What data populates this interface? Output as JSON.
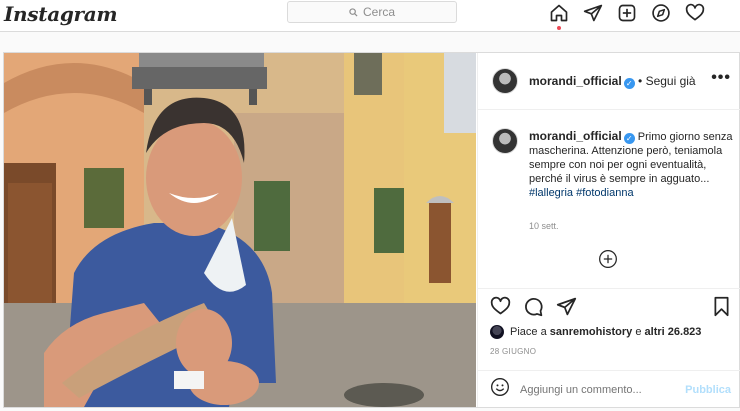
{
  "nav": {
    "logo": "Instagram",
    "search_placeholder": "Cerca",
    "icons": [
      "home-icon",
      "direct-icon",
      "new-post-icon",
      "explore-icon",
      "activity-heart-icon"
    ]
  },
  "post": {
    "author": "morandi_official",
    "follow_text": "• Segui già",
    "more": "•••",
    "caption": {
      "username": "morandi_official",
      "text": "Primo giorno senza mascherina. Attenzione però, teniamola sempre con noi per ogni eventualità, perché il virus è sempre in agguato...",
      "hashtags": "#lallegria #fotodianna"
    },
    "time": "10 sett.",
    "likes": {
      "prefix": "Piace a ",
      "user": "sanremohistory",
      "middle": " e ",
      "count": "altri 26.823"
    },
    "date": "28 GIUGNO",
    "comment_placeholder": "Aggiungi un commento...",
    "publish": "Pubblica"
  },
  "colors": {
    "accent": "#3897f0",
    "link": "#00376b",
    "publish_disabled": "#b2dffc",
    "notification": "#ed4956"
  }
}
